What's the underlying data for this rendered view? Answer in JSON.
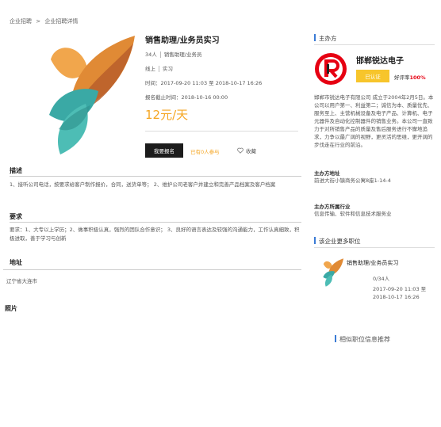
{
  "breadcrumb": {
    "home": "企业招聘",
    "sep": ">",
    "current": "企业招聘详情"
  },
  "job": {
    "title": "销售助理/业务员实习",
    "headcount": "34人",
    "category": "销售助理/业务员",
    "mode": "线上",
    "type": "实习",
    "time": "时间：2017-09-20 11:03 至 2018-10-17 16:26",
    "deadline": "报名截止时间：2018-10-16 00:00",
    "salary": "12元/天",
    "apply_label": "我要报名",
    "applied_text": "已有0人参与",
    "fav_label": "收藏"
  },
  "sections": {
    "desc_title": "描述",
    "desc_text": "1、接听公司电话，按要求给客户制作报价，合同，送货单等； 2、维护公司老客户并建立和完善产品档案及客户档案",
    "req_title": "要求",
    "req_text": "要求：1、大专以上学历；2、做事积极认真，强烈的团队合作意识； 3、良好的语言表达及较强的沟通能力，工作认真细致，积极进取，善于学习与创新",
    "addr_title": "地址",
    "addr_text": "辽宁省大连市",
    "photo_title": "照片"
  },
  "company": {
    "section_title": "主办方",
    "name": "邯郸锐达电子",
    "certified": "已认证",
    "rate_label": "好评率",
    "rate_value": "100%",
    "intro": "邯郸市锐达电子有限公司 成立于2004年2月5日。本公司以用户第一、利益第二；诚信为本、质量优先、服务至上、主营机械设备及电子产品、计算机、电子元器件及自动化控制器件的销售业务。本公司一直致力于对所销售产品的质量及售后服务进行不懈地追求，力争以最广阔的视野，更灵活的思维，更开阔的步伐走在行业的前沿。",
    "addr_head": "主办方地址",
    "addr": "前进大街小镇商务公寓8座1-14-4",
    "industry_head": "主办方所属行业",
    "industry": "信息传输、软件和信息技术服务业"
  },
  "more": {
    "section_title": "该企业更多职位",
    "job_title": "销售助理/业务员实习",
    "count": "0/34人",
    "time_line1": "2017-09-20 11:03 至",
    "time_line2": "2018-10-17 16:26"
  },
  "similar_title": "相似职位信息推荐",
  "colors": {
    "accent": "#f5a623",
    "brand_red": "#e60012",
    "link_blue": "#3a7bd5"
  },
  "icons": {
    "fav": "heart-outline-icon",
    "company_logo": "rd-logo",
    "job_logo": "leaf-logo"
  }
}
